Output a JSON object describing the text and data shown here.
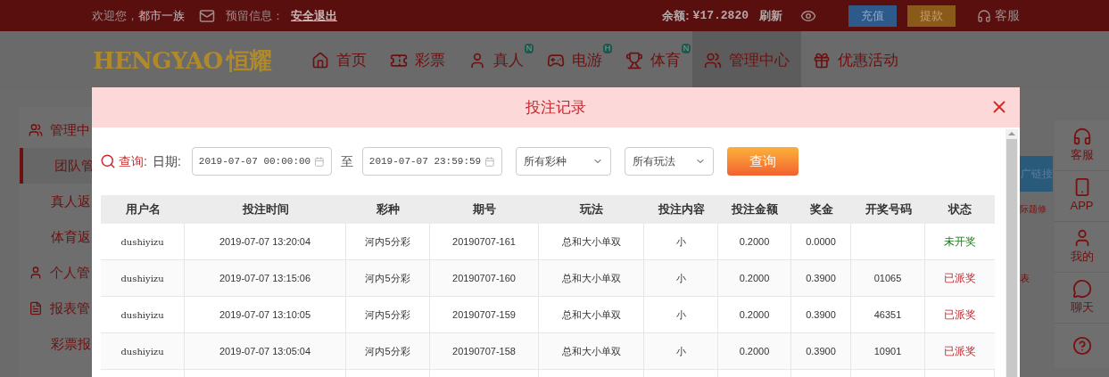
{
  "top_bar": {
    "welcome": "欢迎您，",
    "username": "都市一族",
    "reserved_label": "预留信息：",
    "logout": "安全退出",
    "balance_label": "余额:",
    "balance": "¥17.2820",
    "refresh": "刷新",
    "deposit": "充值",
    "withdraw": "提款",
    "service": "客服"
  },
  "nav": {
    "logo": "HENGYAO",
    "logo_cn": "恒耀",
    "items": [
      {
        "label": "首页",
        "selected": false
      },
      {
        "label": "彩票",
        "selected": false
      },
      {
        "label": "真人",
        "badge": "N",
        "selected": false
      },
      {
        "label": "电游",
        "badge": "H",
        "selected": false
      },
      {
        "label": "体育",
        "badge": "N",
        "selected": false
      },
      {
        "label": "管理中心",
        "selected": true
      },
      {
        "label": "优惠活动",
        "selected": false
      }
    ]
  },
  "sidebar": {
    "items": [
      {
        "label": "管理中",
        "kind": "group",
        "selected": false
      },
      {
        "label": "团队管",
        "kind": "item",
        "selected": true
      },
      {
        "label": "真人返",
        "kind": "item",
        "selected": false
      },
      {
        "label": "体育返",
        "kind": "item",
        "selected": false
      },
      {
        "label": "个人管",
        "kind": "group",
        "selected": false
      },
      {
        "label": "报表管",
        "kind": "group",
        "selected": false
      },
      {
        "label": "彩票报",
        "kind": "item",
        "selected": false
      }
    ]
  },
  "behind": {
    "link_button": "广链接",
    "notice": "际题修",
    "mark": "表"
  },
  "float_bar": [
    {
      "label": "客服"
    },
    {
      "label": "APP"
    },
    {
      "label": "我的"
    },
    {
      "label": "聊天"
    }
  ],
  "modal": {
    "title": "投注记录",
    "query_label": "查询:",
    "date_label": "日期:",
    "date_from": "2019-07-07 00:00:00",
    "to": "至",
    "date_to": "2019-07-07 23:59:59",
    "lottery_select": "所有彩种",
    "play_select": "所有玩法",
    "query_button": "查询",
    "table": {
      "columns": [
        "用户名",
        "投注时间",
        "彩种",
        "期号",
        "玩法",
        "投注内容",
        "投注金额",
        "奖金",
        "开奖号码",
        "状态"
      ],
      "rows": [
        {
          "cells": [
            "dushiyizu",
            "2019-07-07 13:20:04",
            "河内5分彩",
            "20190707-161",
            "总和大小单双",
            "小",
            "0.2000",
            "0.0000",
            ""
          ],
          "status": "未开奖",
          "kind": "pending"
        },
        {
          "cells": [
            "dushiyizu",
            "2019-07-07 13:15:06",
            "河内5分彩",
            "20190707-160",
            "总和大小单双",
            "小",
            "0.2000",
            "0.3900",
            "01065"
          ],
          "status": "已派奖",
          "kind": "paid"
        },
        {
          "cells": [
            "dushiyizu",
            "2019-07-07 13:10:05",
            "河内5分彩",
            "20190707-159",
            "总和大小单双",
            "小",
            "0.2000",
            "0.3900",
            "46351"
          ],
          "status": "已派奖",
          "kind": "paid"
        },
        {
          "cells": [
            "dushiyizu",
            "2019-07-07 13:05:04",
            "河内5分彩",
            "20190707-158",
            "总和大小单双",
            "小",
            "0.2000",
            "0.3900",
            "10901"
          ],
          "status": "已派奖",
          "kind": "paid"
        }
      ]
    }
  }
}
